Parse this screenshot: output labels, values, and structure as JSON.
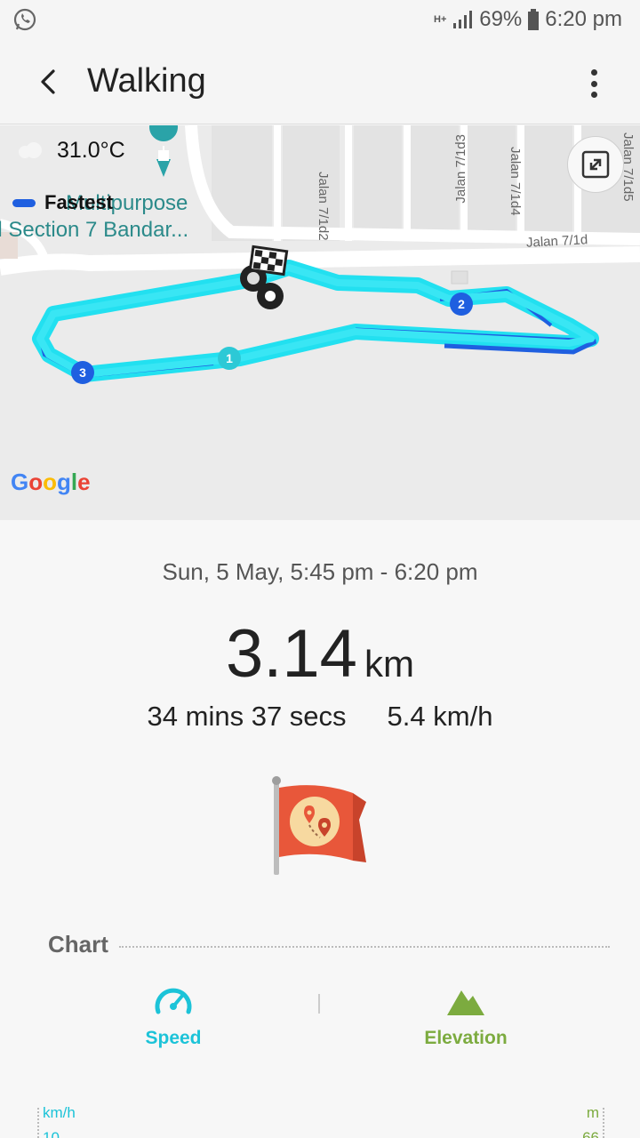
{
  "status_bar": {
    "network": "H+",
    "battery": "69%",
    "time": "6:20 pm",
    "left_icon": "whatsapp-icon"
  },
  "appbar": {
    "title": "Walking",
    "back_icon": "back-arrow-icon",
    "more_icon": "more-vert-icon"
  },
  "map": {
    "temperature": "31.0°C",
    "poi_label_1": "Multipurpose",
    "poi_label_2": "ll Section 7 Bandar...",
    "legend_label": "Fastest",
    "streets": [
      "Jalan 7/1d2",
      "Jalan 7/1d3",
      "Jalan 7/1d4",
      "Jalan 7/1d5",
      "Jalan 7/1d"
    ],
    "lap_markers": [
      "1",
      "2",
      "3"
    ],
    "google": [
      "G",
      "o",
      "o",
      "g",
      "l",
      "e"
    ],
    "route_color": "#22e0f0",
    "fastest_color": "#1f5fe0"
  },
  "summary": {
    "date": "Sun, 5 May, 5:45 pm - 6:20 pm",
    "distance": "3.14",
    "distance_unit": "km",
    "duration": "34 mins 37 secs",
    "avg_speed": "5.4 km/h"
  },
  "chart": {
    "section_title": "Chart",
    "tabs": [
      {
        "label": "Speed",
        "icon": "speedometer-icon",
        "color": "#1cc3d8"
      },
      {
        "label": "Elevation",
        "icon": "mountain-icon",
        "color": "#7cab3f"
      }
    ],
    "left_unit": "km/h",
    "right_unit": "m",
    "left_tick": "10",
    "right_tick": "66"
  }
}
